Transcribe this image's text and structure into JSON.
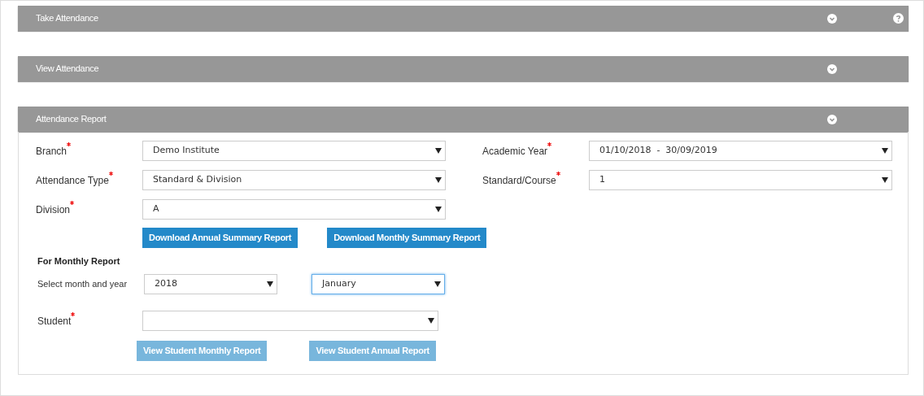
{
  "panels": [
    {
      "title": "Take Attendance",
      "expanded": false,
      "help": true
    },
    {
      "title": "View Attendance",
      "expanded": false,
      "help": false
    },
    {
      "title": "Attendance Report",
      "expanded": true,
      "help": false
    }
  ],
  "report": {
    "left_fields": [
      {
        "label": "Branch",
        "required": true,
        "value": "Demo Institute"
      },
      {
        "label": "Attendance Type",
        "required": true,
        "value": "Standard & Division"
      },
      {
        "label": "Division",
        "required": true,
        "value": "A"
      }
    ],
    "right_fields": [
      {
        "label": "Academic Year",
        "required": true,
        "value": "01/10/2018  -  30/09/2019"
      },
      {
        "label": "Standard/Course",
        "required": true,
        "value": "1"
      }
    ],
    "download_buttons": [
      {
        "label": "Download Annual Summary Report",
        "disabled": false
      },
      {
        "label": "Download Monthly Summary Report",
        "disabled": false
      }
    ],
    "monthly_heading": "For Monthly Report",
    "month_row": {
      "label": "Select month and year",
      "year": {
        "value": "2018",
        "focused": false
      },
      "month": {
        "value": "January",
        "focused": true
      }
    },
    "student": {
      "label": "Student",
      "required": true
    },
    "view_buttons": [
      {
        "label": "View Student Monthly Report",
        "disabled": true
      },
      {
        "label": "View Student Annual Report",
        "disabled": true
      }
    ]
  }
}
